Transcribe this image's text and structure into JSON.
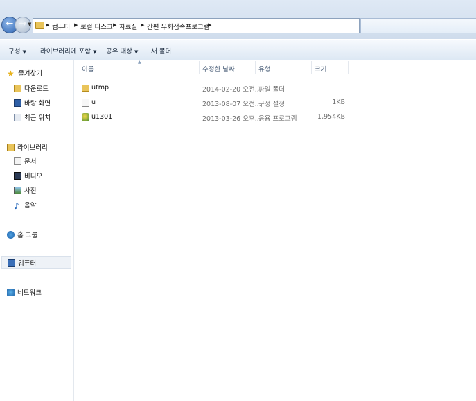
{
  "address": {
    "breadcrumbs": [
      "컴퓨터",
      "로컬 디스크",
      "자료실",
      "간편 우회접속프로그램"
    ]
  },
  "toolbar": {
    "organize": "구성",
    "include_library": "라이브러리에 포함",
    "share": "공유 대상",
    "new_folder": "새 폴더"
  },
  "nav": {
    "favorites": "즐겨찾기",
    "downloads": "다운로드",
    "desktop": "바탕 화면",
    "recent": "최근 위치",
    "libraries": "라이브러리",
    "documents": "문서",
    "videos": "비디오",
    "pictures": "사진",
    "music": "음악",
    "homegroup": "홈 그룹",
    "computer": "컴퓨터",
    "network": "네트워크"
  },
  "columns": {
    "name": "이름",
    "modified": "수정한 날짜",
    "type": "유형",
    "size": "크기"
  },
  "files": [
    {
      "name": "utmp",
      "modified": "2014-02-20 오전...",
      "type": "파일 폴더",
      "size": "",
      "icon": "folder-icon"
    },
    {
      "name": "u",
      "modified": "2013-08-07 오전...",
      "type": "구성 설정",
      "size": "1KB",
      "icon": "config-file-icon"
    },
    {
      "name": "u1301",
      "modified": "2013-03-26 오후...",
      "type": "응용 프로그램",
      "size": "1,954KB",
      "icon": "application-icon"
    }
  ],
  "colors": {
    "accent": "#2c63b2",
    "toolbar_bg": "#dde8f4",
    "folder": "#e9c45a"
  }
}
